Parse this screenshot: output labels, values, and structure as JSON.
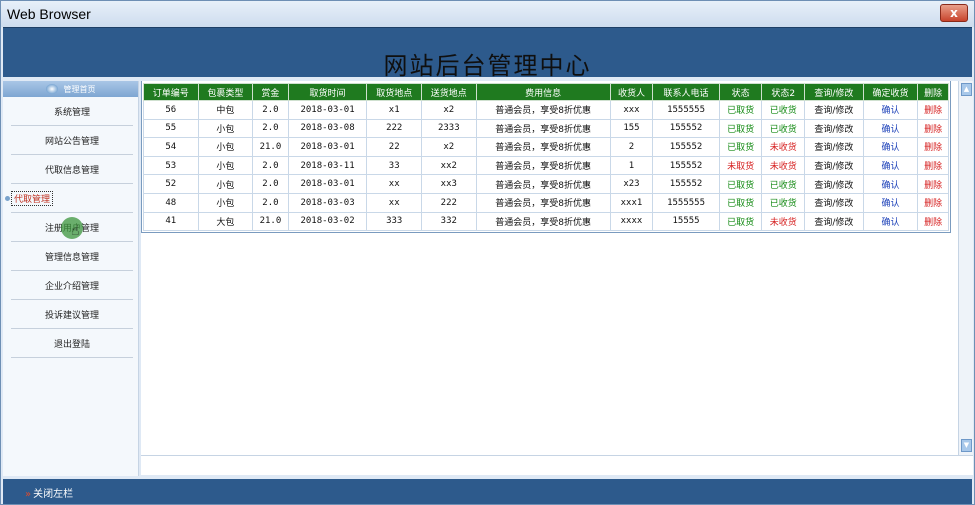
{
  "window": {
    "title": "Web Browser",
    "close_glyph": "x"
  },
  "header": {
    "title": "网站后台管理中心"
  },
  "sidebar": {
    "head": "管理首页",
    "items": [
      {
        "label": "系统管理"
      },
      {
        "label": "网站公告管理"
      },
      {
        "label": "代取信息管理"
      },
      {
        "label": "代取管理"
      },
      {
        "label": "注册用户管理"
      },
      {
        "label": "管理信息管理"
      },
      {
        "label": "企业介绍管理"
      },
      {
        "label": "投诉建议管理"
      },
      {
        "label": "退出登陆"
      }
    ],
    "active_index": 3
  },
  "table": {
    "columns": [
      "订单编号",
      "包裹类型",
      "赏金",
      "取货时间",
      "取货地点",
      "送货地点",
      "费用信息",
      "收货人",
      "联系人电话",
      "状态",
      "状态2",
      "查询/修改",
      "确定收货",
      "删除"
    ],
    "rows": [
      [
        "56",
        "中包",
        "2.0",
        "2018-03-01",
        "x1",
        "x2",
        "普通会员，享受8折优惠",
        "xxx",
        "1555555",
        "已取货",
        "已收货",
        "查询/修改",
        "确认",
        "删除"
      ],
      [
        "55",
        "小包",
        "2.0",
        "2018-03-08",
        "222",
        "2333",
        "普通会员，享受8折优惠",
        "155",
        "155552",
        "已取货",
        "已收货",
        "查询/修改",
        "确认",
        "删除"
      ],
      [
        "54",
        "小包",
        "21.0",
        "2018-03-01",
        "22",
        "x2",
        "普通会员，享受8折优惠",
        "2",
        "155552",
        "已取货",
        "未收货",
        "查询/修改",
        "确认",
        "删除"
      ],
      [
        "53",
        "小包",
        "2.0",
        "2018-03-11",
        "33",
        "xx2",
        "普通会员，享受8折优惠",
        "1",
        "155552",
        "未取货",
        "未收货",
        "查询/修改",
        "确认",
        "删除"
      ],
      [
        "52",
        "小包",
        "2.0",
        "2018-03-01",
        "xx",
        "xx3",
        "普通会员，享受8折优惠",
        "x23",
        "155552",
        "已取货",
        "已收货",
        "查询/修改",
        "确认",
        "删除"
      ],
      [
        "48",
        "小包",
        "2.0",
        "2018-03-03",
        "xx",
        "222",
        "普通会员，享受8折优惠",
        "xxx1",
        "1555555",
        "已取货",
        "已收货",
        "查询/修改",
        "确认",
        "删除"
      ],
      [
        "41",
        "大包",
        "21.0",
        "2018-03-02",
        "333",
        "332",
        "普通会员，享受8折优惠",
        "xxxx",
        "15555",
        "已取货",
        "未收货",
        "查询/修改",
        "确认",
        "删除"
      ]
    ]
  },
  "footer": {
    "close_left": "关闭左栏"
  },
  "colors": {
    "banner": "#2d5a8c",
    "table_header": "#1f7a1f",
    "status_ok": "#138a13",
    "status_no": "#d62020",
    "link": "#1a3fb8"
  }
}
